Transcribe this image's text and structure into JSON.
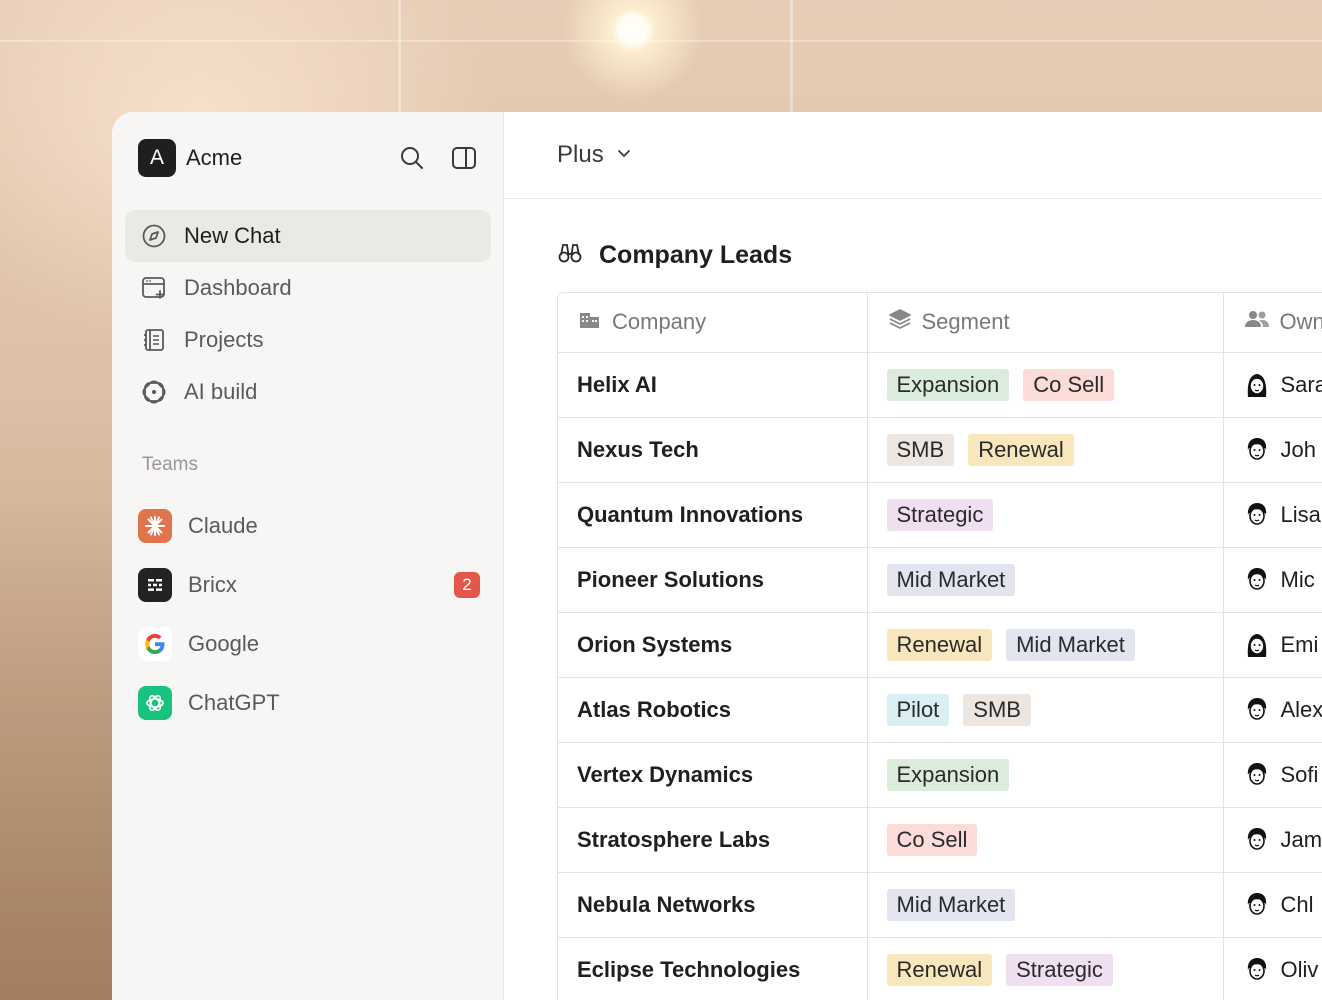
{
  "workspace": {
    "logo_letter": "A",
    "name": "Acme"
  },
  "sidebar": {
    "nav": [
      {
        "label": "New Chat",
        "icon": "compass-icon",
        "active": true
      },
      {
        "label": "Dashboard",
        "icon": "browser-window-icon",
        "active": false
      },
      {
        "label": "Projects",
        "icon": "book-icon",
        "active": false
      },
      {
        "label": "AI build",
        "icon": "atom-icon",
        "active": false
      }
    ],
    "teams_label": "Teams",
    "teams": [
      {
        "name": "Claude",
        "icon": "claude-logo",
        "color": "#e0744d",
        "badge": ""
      },
      {
        "name": "Bricx",
        "icon": "bricx-logo",
        "color": "#232323",
        "badge": "2"
      },
      {
        "name": "Google",
        "icon": "google-logo",
        "color": "#ffffff",
        "badge": ""
      },
      {
        "name": "ChatGPT",
        "icon": "chatgpt-logo",
        "color": "#19c37d",
        "badge": ""
      }
    ]
  },
  "topbar": {
    "plan": "Plus"
  },
  "leads": {
    "title": "Company Leads",
    "columns": {
      "company": "Company",
      "segment": "Segment",
      "owner": "Own"
    },
    "rows": [
      {
        "company": "Helix AI",
        "segments": [
          "Expansion",
          "Co Sell"
        ],
        "owner": "Sara"
      },
      {
        "company": "Nexus Tech",
        "segments": [
          "SMB",
          "Renewal"
        ],
        "owner": "Joh"
      },
      {
        "company": "Quantum Innovations",
        "segments": [
          "Strategic"
        ],
        "owner": "Lisa"
      },
      {
        "company": "Pioneer Solutions",
        "segments": [
          "Mid Market"
        ],
        "owner": "Mic"
      },
      {
        "company": "Orion Systems",
        "segments": [
          "Renewal",
          "Mid Market"
        ],
        "owner": "Emi"
      },
      {
        "company": "Atlas Robotics",
        "segments": [
          "Pilot",
          "SMB"
        ],
        "owner": "Alex"
      },
      {
        "company": "Vertex Dynamics",
        "segments": [
          "Expansion"
        ],
        "owner": "Sofi"
      },
      {
        "company": "Stratosphere Labs",
        "segments": [
          "Co Sell"
        ],
        "owner": "Jam"
      },
      {
        "company": "Nebula Networks",
        "segments": [
          "Mid Market"
        ],
        "owner": "Chl"
      },
      {
        "company": "Eclipse Technologies",
        "segments": [
          "Renewal",
          "Strategic"
        ],
        "owner": "Oliv"
      }
    ],
    "tag_colors": {
      "Expansion": "#dcecdc",
      "Co Sell": "#fbdcd8",
      "SMB": "#ece5e0",
      "Renewal": "#f8e6bc",
      "Strategic": "#efdff0",
      "Mid Market": "#e2e4ef",
      "Pilot": "#daeff3"
    }
  }
}
